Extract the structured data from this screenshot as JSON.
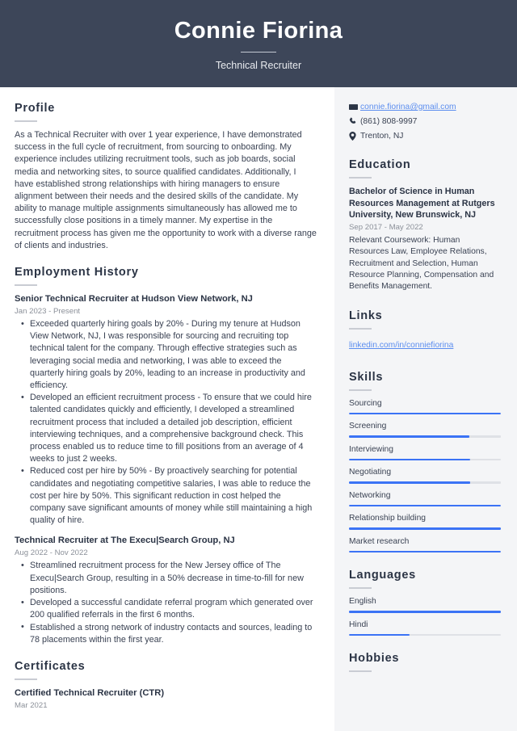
{
  "header": {
    "name": "Connie Fiorina",
    "title": "Technical Recruiter"
  },
  "colors": {
    "header_bg": "#3d4659",
    "sidebar_bg": "#f4f5f7",
    "accent_blue": "#3b73f5",
    "link_blue": "#5b8def",
    "text": "#3a4253",
    "muted": "#8b9099"
  },
  "main": {
    "profile": {
      "heading": "Profile",
      "text": "As a Technical Recruiter with over 1 year experience, I have demonstrated success in the full cycle of recruitment, from sourcing to onboarding. My experience includes utilizing recruitment tools, such as job boards, social media and networking sites, to source qualified candidates. Additionally, I have established strong relationships with hiring managers to ensure alignment between their needs and the desired skills of the candidate. My ability to manage multiple assignments simultaneously has allowed me to successfully close positions in a timely manner. My expertise in the recruitment process has given me the opportunity to work with a diverse range of clients and industries."
    },
    "employment": {
      "heading": "Employment History",
      "jobs": [
        {
          "title": "Senior Technical Recruiter at Hudson View Network, NJ",
          "date": "Jan 2023 - Present",
          "bullets": [
            "Exceeded quarterly hiring goals by 20% - During my tenure at Hudson View Network, NJ, I was responsible for sourcing and recruiting top technical talent for the company. Through effective strategies such as leveraging social media and networking, I was able to exceed the quarterly hiring goals by 20%, leading to an increase in productivity and efficiency.",
            "Developed an efficient recruitment process - To ensure that we could hire talented candidates quickly and efficiently, I developed a streamlined recruitment process that included a detailed job description, efficient interviewing techniques, and a comprehensive background check. This process enabled us to reduce time to fill positions from an average of 4 weeks to just 2 weeks.",
            "Reduced cost per hire by 50% - By proactively searching for potential candidates and negotiating competitive salaries, I was able to reduce the cost per hire by 50%. This significant reduction in cost helped the company save significant amounts of money while still maintaining a high quality of hire."
          ]
        },
        {
          "title": "Technical Recruiter at The Execu|Search Group, NJ",
          "date": "Aug 2022 - Nov 2022",
          "bullets": [
            "Streamlined recruitment process for the New Jersey office of The Execu|Search Group, resulting in a 50% decrease in time-to-fill for new positions.",
            "Developed a successful candidate referral program which generated over 200 qualified referrals in the first 6 months.",
            "Established a strong network of industry contacts and sources, leading to 78 placements within the first year."
          ]
        }
      ]
    },
    "certificates": {
      "heading": "Certificates",
      "items": [
        {
          "title": "Certified Technical Recruiter (CTR)",
          "date": "Mar 2021"
        }
      ]
    }
  },
  "sidebar": {
    "contact": [
      {
        "icon": "email-icon",
        "text": "connie.fiorina@gmail.com",
        "is_link": true
      },
      {
        "icon": "phone-icon",
        "text": "(861) 808-9997",
        "is_link": false
      },
      {
        "icon": "location-icon",
        "text": "Trenton, NJ",
        "is_link": false
      }
    ],
    "education": {
      "heading": "Education",
      "items": [
        {
          "degree": "Bachelor of Science in Human Resources Management at Rutgers University, New Brunswick, NJ",
          "date": "Sep 2017 - May 2022",
          "description": "Relevant Coursework: Human Resources Law, Employee Relations, Recruitment and Selection, Human Resource Planning, Compensation and Benefits Management."
        }
      ]
    },
    "links": {
      "heading": "Links",
      "items": [
        {
          "label": "linkedin.com/in/conniefiorina"
        }
      ]
    },
    "skills": {
      "heading": "Skills",
      "items": [
        {
          "label": "Sourcing",
          "level": 100
        },
        {
          "label": "Screening",
          "level": 79
        },
        {
          "label": "Interviewing",
          "level": 80
        },
        {
          "label": "Negotiating",
          "level": 80
        },
        {
          "label": "Networking",
          "level": 100
        },
        {
          "label": "Relationship building",
          "level": 100
        },
        {
          "label": "Market research",
          "level": 100
        }
      ]
    },
    "languages": {
      "heading": "Languages",
      "items": [
        {
          "label": "English",
          "level": 100
        },
        {
          "label": "Hindi",
          "level": 40
        }
      ]
    },
    "hobbies": {
      "heading": "Hobbies"
    }
  }
}
